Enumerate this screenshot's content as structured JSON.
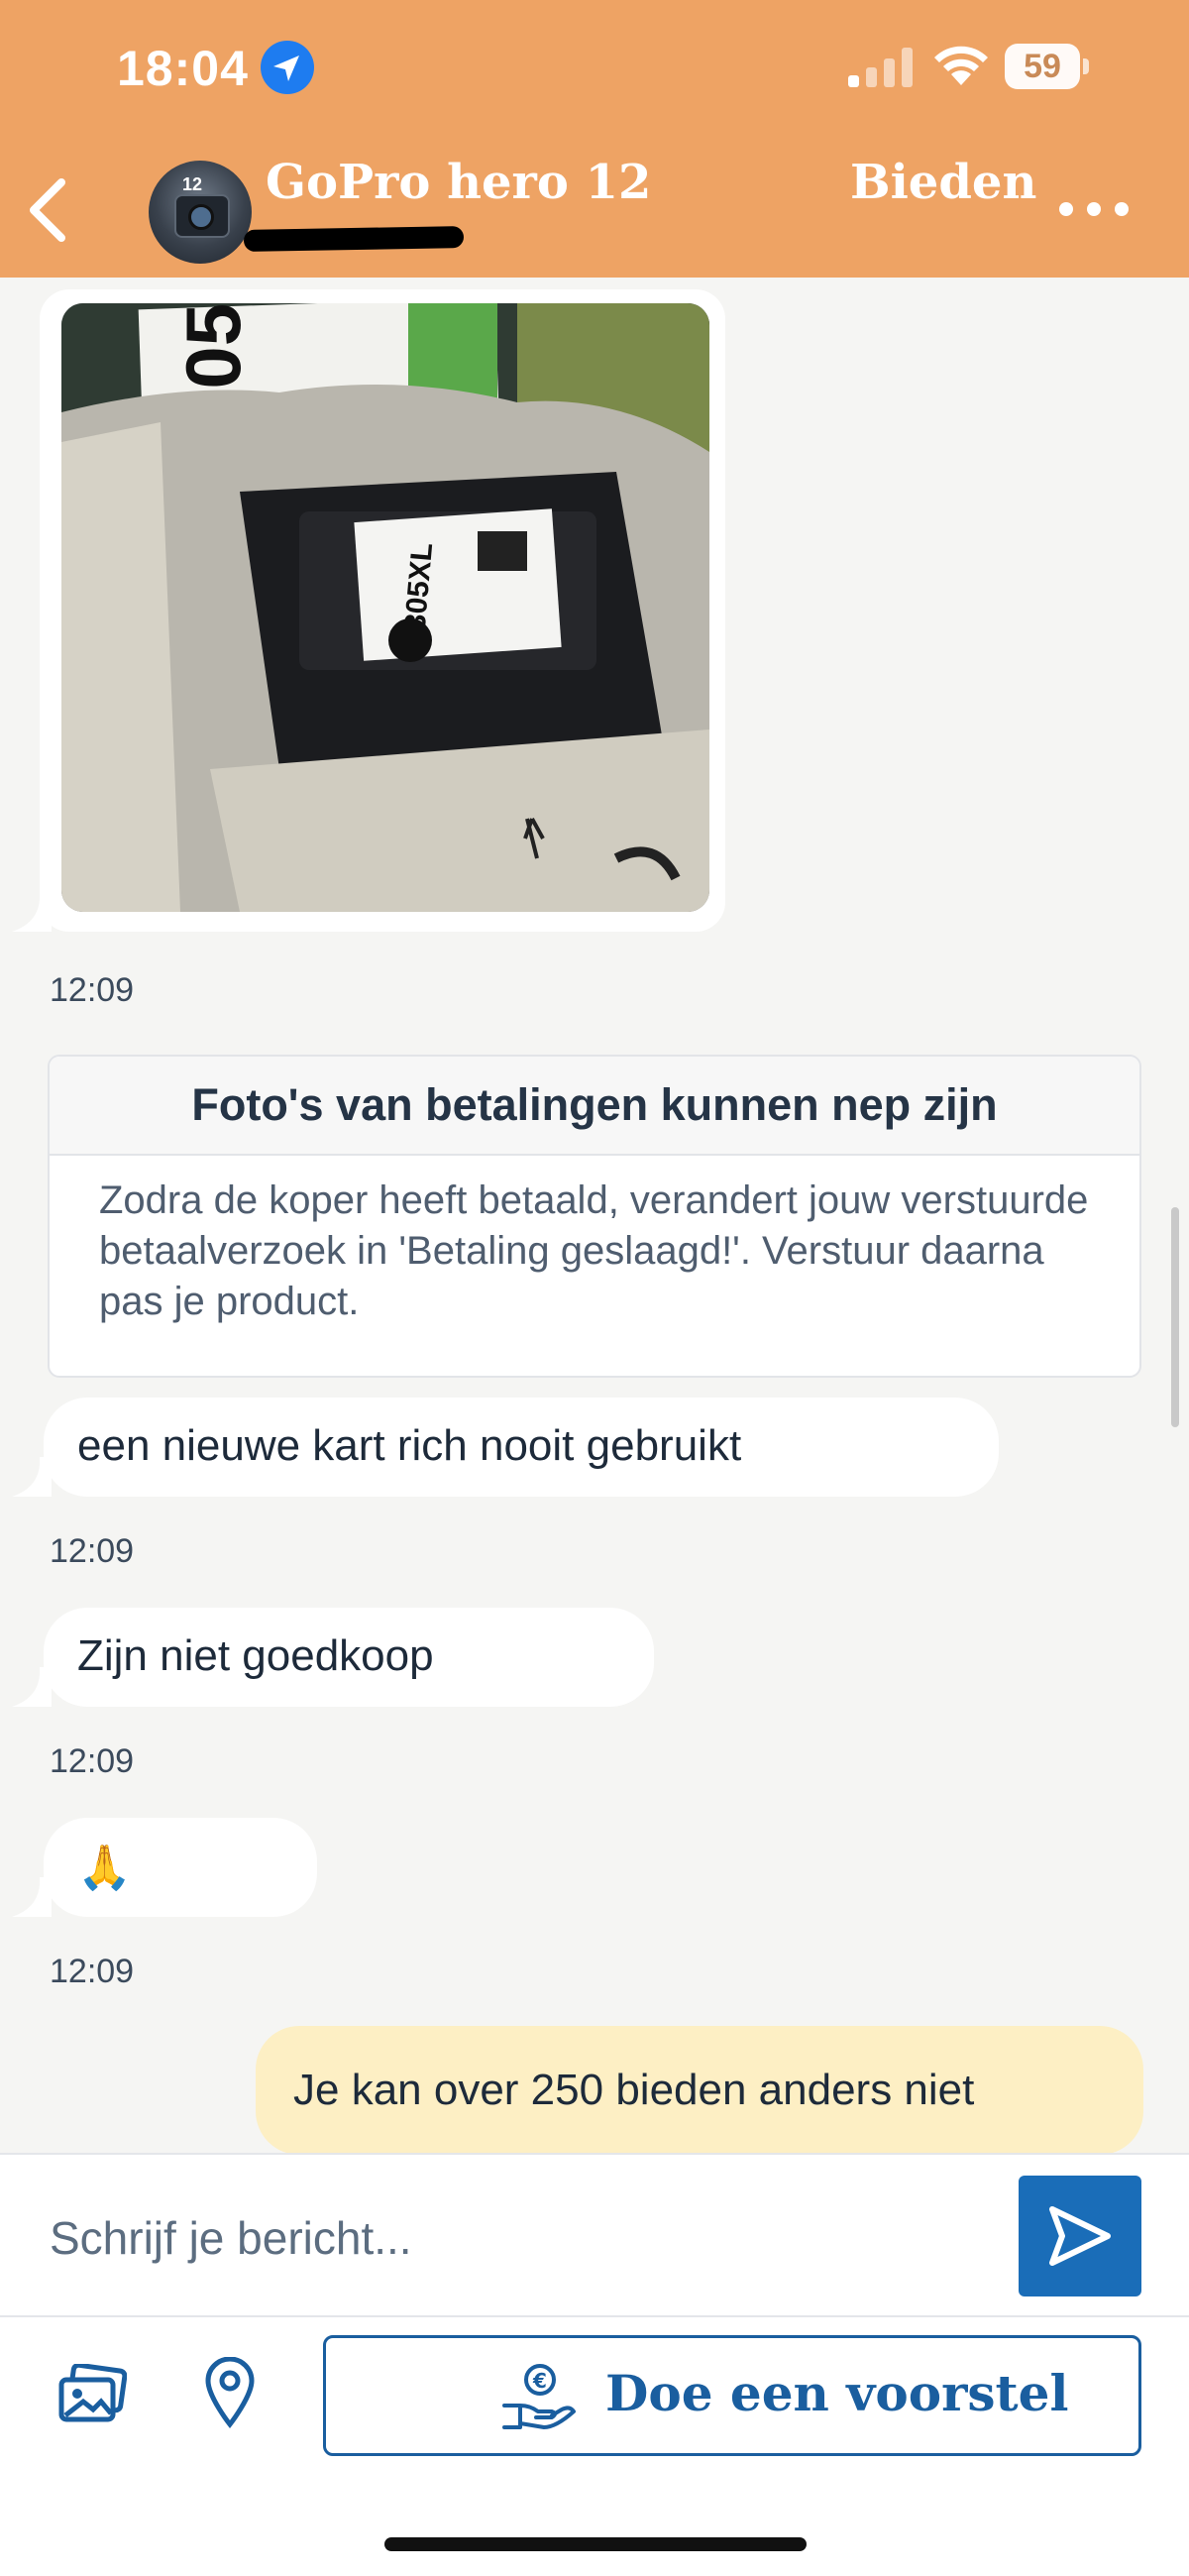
{
  "status_bar": {
    "time": "18:04",
    "battery": "59"
  },
  "header": {
    "title": "GoPro hero 12",
    "action": "Bieden",
    "avatar_badge": "12"
  },
  "messages": [
    {
      "type": "photo",
      "time": "12:09",
      "image": "hp-305xl-ink-cartridge-photo"
    },
    {
      "type": "notice",
      "title": "Foto's van betalingen kunnen nep zijn",
      "body": "Zodra de koper heeft betaald, verandert jouw verstuurde betaalverzoek in 'Betaling geslaagd!'. Verstuur daarna pas je product."
    },
    {
      "type": "text",
      "text": "een nieuwe kart rich nooit gebruikt",
      "time": "12:09"
    },
    {
      "type": "text",
      "text": "Zijn niet goedkoop",
      "time": "12:09"
    },
    {
      "type": "text",
      "text": "🙏",
      "time": "12:09"
    },
    {
      "type": "text-own",
      "text": "Je kan over 250 bieden anders niet"
    }
  ],
  "composer": {
    "placeholder": "Schrijf je bericht...",
    "offer_label": "Doe een voorstel"
  },
  "colors": {
    "header": "#eea364",
    "brand_blue": "#1a6db8",
    "own_bubble": "#fdefc4"
  }
}
